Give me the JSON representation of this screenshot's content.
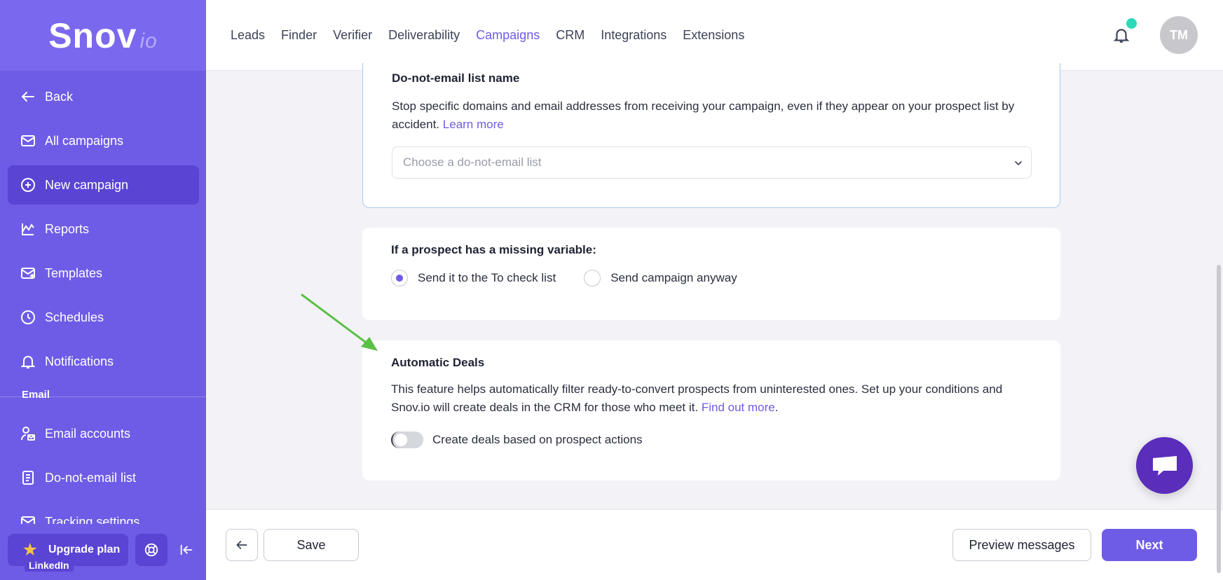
{
  "sidebar": {
    "logo_main": "Snov",
    "logo_suffix": "io",
    "items": [
      {
        "label": "Back",
        "icon": "arrow-left-icon"
      },
      {
        "label": "All campaigns",
        "icon": "envelope-icon"
      },
      {
        "label": "New campaign",
        "icon": "plus-circle-icon",
        "active": true
      },
      {
        "label": "Reports",
        "icon": "chart-icon"
      },
      {
        "label": "Templates",
        "icon": "template-icon"
      },
      {
        "label": "Schedules",
        "icon": "clock-icon"
      },
      {
        "label": "Notifications",
        "icon": "bell-icon"
      }
    ],
    "section_email": "Email",
    "email_items": [
      {
        "label": "Email accounts",
        "icon": "user-mail-icon"
      },
      {
        "label": "Do-not-email list",
        "icon": "list-icon"
      },
      {
        "label": "Tracking settings",
        "icon": "mail-icon"
      }
    ],
    "upgrade_label": "Upgrade plan",
    "linkedin_tag": "LinkedIn"
  },
  "topnav": {
    "items": [
      "Leads",
      "Finder",
      "Verifier",
      "Deliverability",
      "Campaigns",
      "CRM",
      "Integrations",
      "Extensions"
    ],
    "active": "Campaigns",
    "avatar_initials": "TM"
  },
  "card_dne": {
    "title": "Do-not-email list name",
    "text": "Stop specific domains and email addresses from receiving your campaign, even if they appear on your prospect list by accident.",
    "link": "Learn more",
    "select_placeholder": "Choose a do-not-email list"
  },
  "card_missing": {
    "title": "If a prospect has a missing variable:",
    "option1": "Send it to the To check list",
    "option2": "Send campaign anyway"
  },
  "card_deals": {
    "title": "Automatic Deals",
    "text": "This feature helps automatically filter ready-to-convert prospects from uninterested ones. Set up your conditions and Snov.io will create deals in the CRM for those who meet it.",
    "link": "Find out more",
    "toggle_label": "Create deals based on prospect actions"
  },
  "footer": {
    "save": "Save",
    "preview": "Preview messages",
    "next": "Next"
  },
  "colors": {
    "brand": "#6e5ce6",
    "accent_dot": "#2bd9b9",
    "annotation_arrow": "#5cc047"
  }
}
